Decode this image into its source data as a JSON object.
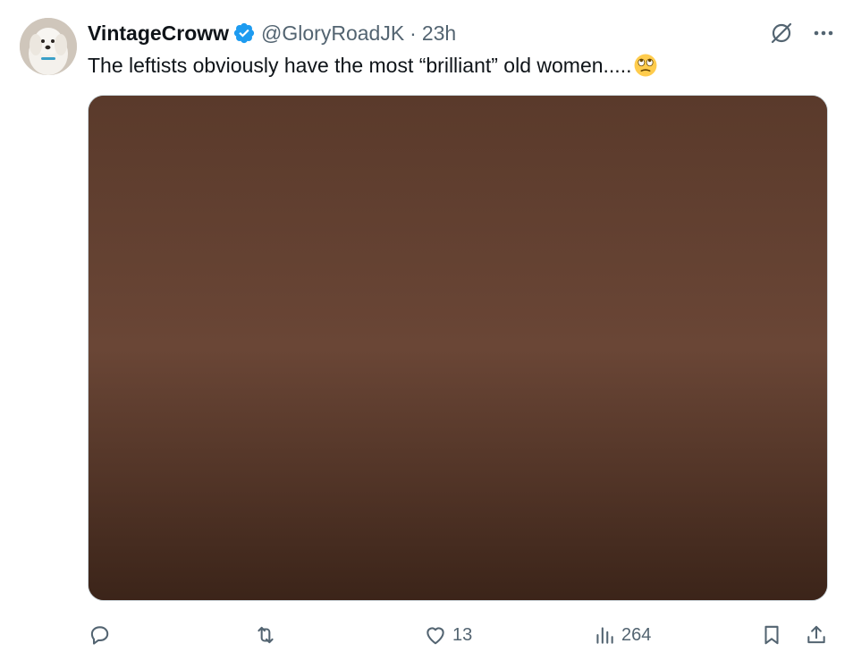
{
  "author": {
    "display_name": "VintageCroww",
    "handle": "@GloryRoadJK",
    "separator": "·",
    "time": "23h",
    "verified": true
  },
  "post": {
    "text": "The leftists obviously have the most “brilliant” old women.....",
    "emoji": "face-with-rolling-eyes",
    "media_alt": ""
  },
  "actions": {
    "replies": "",
    "reposts": "",
    "likes": "13",
    "views": "264"
  },
  "icons": {
    "verified": "verified-badge-icon",
    "grok": "grok-icon",
    "more": "more-icon",
    "reply": "reply-icon",
    "repost": "repost-icon",
    "like": "heart-icon",
    "views": "views-icon",
    "bookmark": "bookmark-icon",
    "share": "share-icon"
  },
  "colors": {
    "text": "#0f1419",
    "secondary": "#536471",
    "verified": "#1d9bf0"
  }
}
